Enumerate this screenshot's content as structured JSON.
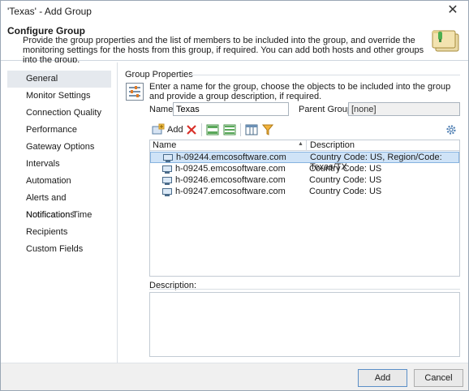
{
  "window": {
    "title": "'Texas' - Add Group",
    "close_glyph": "✕"
  },
  "header": {
    "title": "Configure Group",
    "description": "Provide the group properties and the list of members to be included into the group, and override the monitoring settings for the hosts from this group, if required. You can add both hosts and other groups into the group.",
    "icon": "folder-icon"
  },
  "nav": {
    "items": [
      {
        "label": "General",
        "selected": true
      },
      {
        "label": "Monitor Settings"
      },
      {
        "label": "Connection Quality"
      },
      {
        "label": "Performance"
      },
      {
        "label": "Gateway Options"
      },
      {
        "label": "Intervals"
      },
      {
        "label": "Automation"
      },
      {
        "label": "Alerts and Notifications"
      },
      {
        "label": "Notification Time"
      },
      {
        "label": "Recipients"
      },
      {
        "label": "Custom Fields"
      }
    ]
  },
  "group_properties": {
    "legend": "Group Properties",
    "description": "Enter a name for the group, choose the objects to be included into the group and provide a group description, if required.",
    "name_label": "Name:",
    "name_value": "Texas",
    "parent_label": "Parent Group:",
    "parent_value": "[none]"
  },
  "toolbar": {
    "add_label": "Add"
  },
  "grid": {
    "columns": {
      "name": "Name",
      "description": "Description"
    },
    "rows": [
      {
        "name": "h-09244.emcosoftware.com",
        "description": "Country Code: US, Region/Code: Texas/TX",
        "selected": true
      },
      {
        "name": "h-09245.emcosoftware.com",
        "description": "Country Code: US"
      },
      {
        "name": "h-09246.emcosoftware.com",
        "description": "Country Code: US"
      },
      {
        "name": "h-09247.emcosoftware.com",
        "description": "Country Code: US"
      }
    ]
  },
  "description_section": {
    "label": "Description:",
    "value": ""
  },
  "footer": {
    "add_button": "Add",
    "cancel_button": "Cancel"
  },
  "colors": {
    "accent": "#5b8fc7",
    "selection": "#cfe3f7",
    "nav_selected": "#e5e9ee",
    "delete_red": "#d9302a"
  }
}
